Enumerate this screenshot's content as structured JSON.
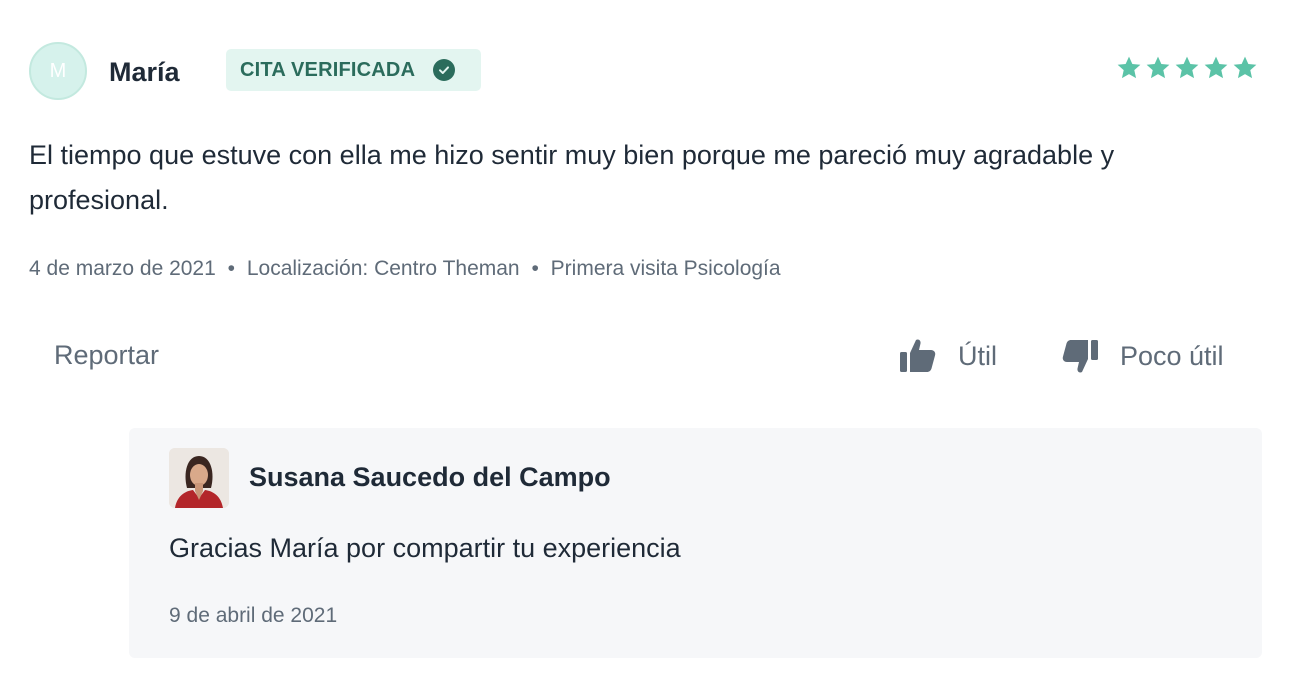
{
  "review": {
    "avatar_initial": "M",
    "reviewer_name": "María",
    "verified_label": "CITA VERIFICADA",
    "rating": 5,
    "rating_max": 5,
    "comment": "El tiempo que estuve con ella me hizo sentir muy bien porque me pareció muy agradable y profesional.",
    "date": "4 de marzo de 2021",
    "location": "Localización: Centro Theman",
    "visit_type": "Primera visita Psicología",
    "separator": "•"
  },
  "actions": {
    "report_label": "Reportar",
    "useful_label": "Útil",
    "not_useful_label": "Poco útil"
  },
  "reply": {
    "doctor_name": "Susana Saucedo del Campo",
    "text": "Gracias María por compartir tu experiencia",
    "date": "9 de abril de 2021"
  },
  "colors": {
    "star": "#5bc3a7",
    "badge_bg": "#e3f5f0",
    "badge_text": "#2b6c5c",
    "icon_gray": "#5f6b78",
    "reply_bg": "#f6f7f9"
  },
  "icons": {
    "verified": "check-circle-icon",
    "useful": "thumbs-up-icon",
    "not_useful": "thumbs-down-icon",
    "rating": "star-icon"
  }
}
